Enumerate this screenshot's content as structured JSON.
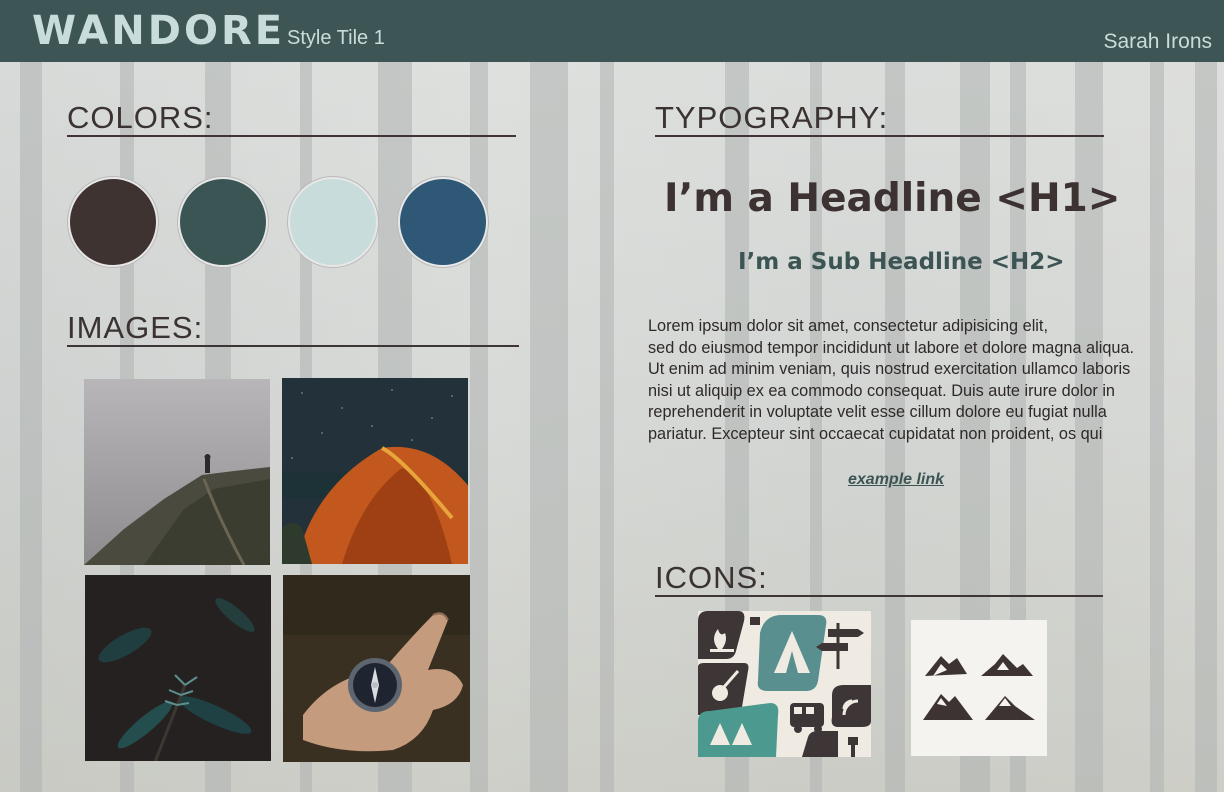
{
  "header": {
    "brand": "WANDORE",
    "subtitle": "Style Tile 1",
    "author": "Sarah Irons"
  },
  "sections": {
    "colors": "COLORS:",
    "images": "IMAGES:",
    "typography": "TYPOGRAPHY:",
    "icons": "ICONS:"
  },
  "colors": [
    "#3e3331",
    "#3a5553",
    "#c9dcdc",
    "#2e5876"
  ],
  "typography": {
    "h1": "I’m a Headline <H1>",
    "h2": "I’m a Sub Headline <H2>",
    "body_lines": [
      "Lorem ipsum dolor sit amet, consectetur adipisicing elit,",
      "sed do eiusmod tempor incididunt ut labore et dolore magna aliqua.",
      "Ut enim ad minim veniam, quis nostrud exercitation ullamco laboris",
      "nisi ut aliquip ex ea commodo consequat. Duis aute irure dolor in",
      "reprehenderit in voluptate velit esse cillum dolore eu fugiat nulla",
      "pariatur. Excepteur sint occaecat cupidatat non proident, os qui"
    ],
    "link": "example link"
  },
  "images": [
    "misty-mountain-hiker",
    "orange-tent-night",
    "pine-branch",
    "compass-in-hand"
  ],
  "icons": [
    "outdoor-icon-set",
    "mountain-icons"
  ]
}
